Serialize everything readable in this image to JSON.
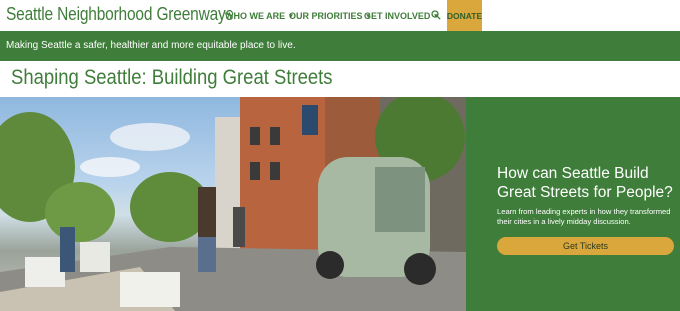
{
  "header": {
    "site_title": "Seattle Neighborhood Greenways",
    "nav": [
      {
        "label": "WHO WE ARE"
      },
      {
        "label": "OUR PRIORITIES"
      },
      {
        "label": "GET INVOLVED"
      }
    ],
    "donate_label": "DONATE",
    "icons": {
      "search": "search-icon",
      "dropdown": "chevron-down-icon"
    }
  },
  "tagline": "Making Seattle a safer, healthier and more equitable place to live.",
  "page_title": "Shaping Seattle: Building Great Streets",
  "promo": {
    "heading": "How can Seattle Build Great Streets for People?",
    "text": "Learn from leading experts in how they transformed their cities in a lively midday discussion.",
    "button_label": "Get Tickets"
  },
  "colors": {
    "brand_green": "#3f7d3a",
    "accent_gold": "#d9a73b",
    "white": "#ffffff"
  }
}
